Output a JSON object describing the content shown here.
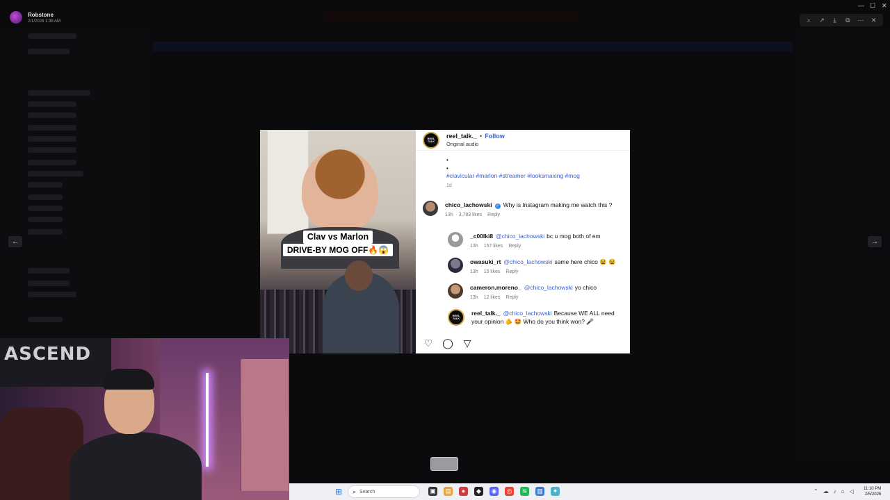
{
  "viewer": {
    "user_name": "Robstone",
    "date": "2/1/2026 1:38 AM",
    "tools": [
      "zoom-icon",
      "share-icon",
      "download-icon",
      "open-external-icon",
      "more-icon"
    ],
    "close_glyph": "✕"
  },
  "post": {
    "media_caption_line1": "Clav vs Marlon",
    "media_caption_line2": "DRIVE-BY MOG OFF🔥😱",
    "author": "reel_talk._",
    "dot": "•",
    "follow_label": "Follow",
    "audio": "Original audio",
    "avatar_text": "REEL TALK",
    "bullets": [
      "•",
      "•"
    ],
    "hashtags": "#clavicular #marlon #streamer #looksmaxing #mog",
    "age": "1d",
    "comments": [
      {
        "user": "chico_lachowski",
        "verified": true,
        "mention": "",
        "text": "Why is Instagram making me watch this ?",
        "time": "13h",
        "likes": "3,783 likes",
        "reply": "Reply"
      },
      {
        "user": "_c00lki8",
        "mention": "@chico_lachowski",
        "text": "bc u mog both of em",
        "time": "13h",
        "likes": "157 likes",
        "reply": "Reply"
      },
      {
        "user": "owasuki_rt",
        "mention": "@chico_lachowski",
        "text": "same here chico 😫 😫",
        "time": "13h",
        "likes": "15 likes",
        "reply": "Reply"
      },
      {
        "user": "cameron.moreno_",
        "mention": "@chico_lachowski",
        "text": "yo chico",
        "time": "13h",
        "likes": "12 likes",
        "reply": "Reply"
      },
      {
        "user": "reel_talk._",
        "mention": "@chico_lachowski",
        "text": "Because WE ALL need",
        "text2": "your opinion 🫵 🤩  Who do you think won? 🎤"
      }
    ],
    "actions": [
      "heart-icon",
      "comment-icon",
      "share-icon"
    ]
  },
  "webcam": {
    "banner_text": "ASCEND"
  },
  "taskbar": {
    "search_label": "Search",
    "clock_time": "11:10 PM",
    "clock_date": "2/5/2026"
  }
}
